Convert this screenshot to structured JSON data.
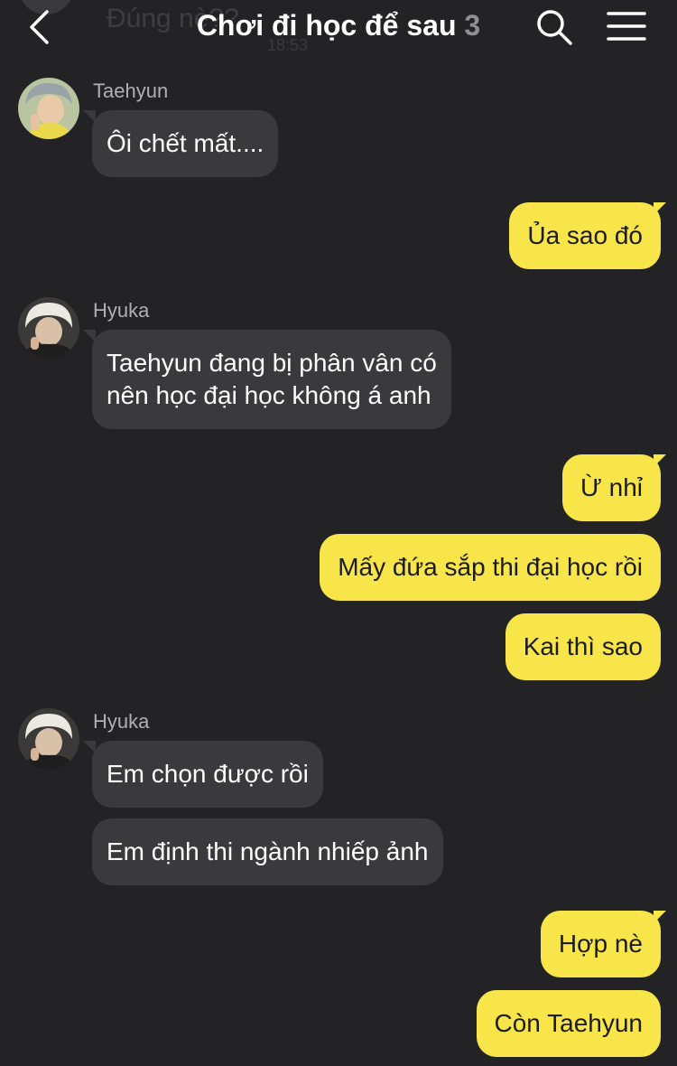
{
  "header": {
    "title": "Chơi đi học để sau",
    "member_count": "3",
    "ghost_preview": "Đúng nè??",
    "ghost_time": "18:53"
  },
  "colors": {
    "background": "#232325",
    "incoming_bubble": "#3a3a3c",
    "outgoing_bubble": "#f7e54a",
    "sender_name": "#b0b0b4"
  },
  "icons": {
    "back": "chevron-left-icon",
    "search": "search-icon",
    "menu": "hamburger-menu-icon"
  },
  "messages": [
    {
      "sender": "Taehyun",
      "direction": "in",
      "text": "Ôi chết mất...."
    },
    {
      "direction": "out",
      "text": "Ủa sao đó"
    },
    {
      "sender": "Hyuka",
      "direction": "in",
      "line1": "Taehyun đang bị phân vân có",
      "line2": "nên học đại học không á anh"
    },
    {
      "direction": "out",
      "text": "Ừ nhỉ"
    },
    {
      "direction": "out",
      "text": "Mấy đứa sắp thi đại học rồi"
    },
    {
      "direction": "out",
      "text": "Kai thì sao"
    },
    {
      "sender": "Hyuka",
      "direction": "in",
      "text": "Em chọn được rồi"
    },
    {
      "direction": "in",
      "text": "Em định thi ngành nhiếp ảnh"
    },
    {
      "direction": "out",
      "text": "Hợp nè"
    },
    {
      "direction": "out",
      "text": "Còn Taehyun"
    }
  ]
}
